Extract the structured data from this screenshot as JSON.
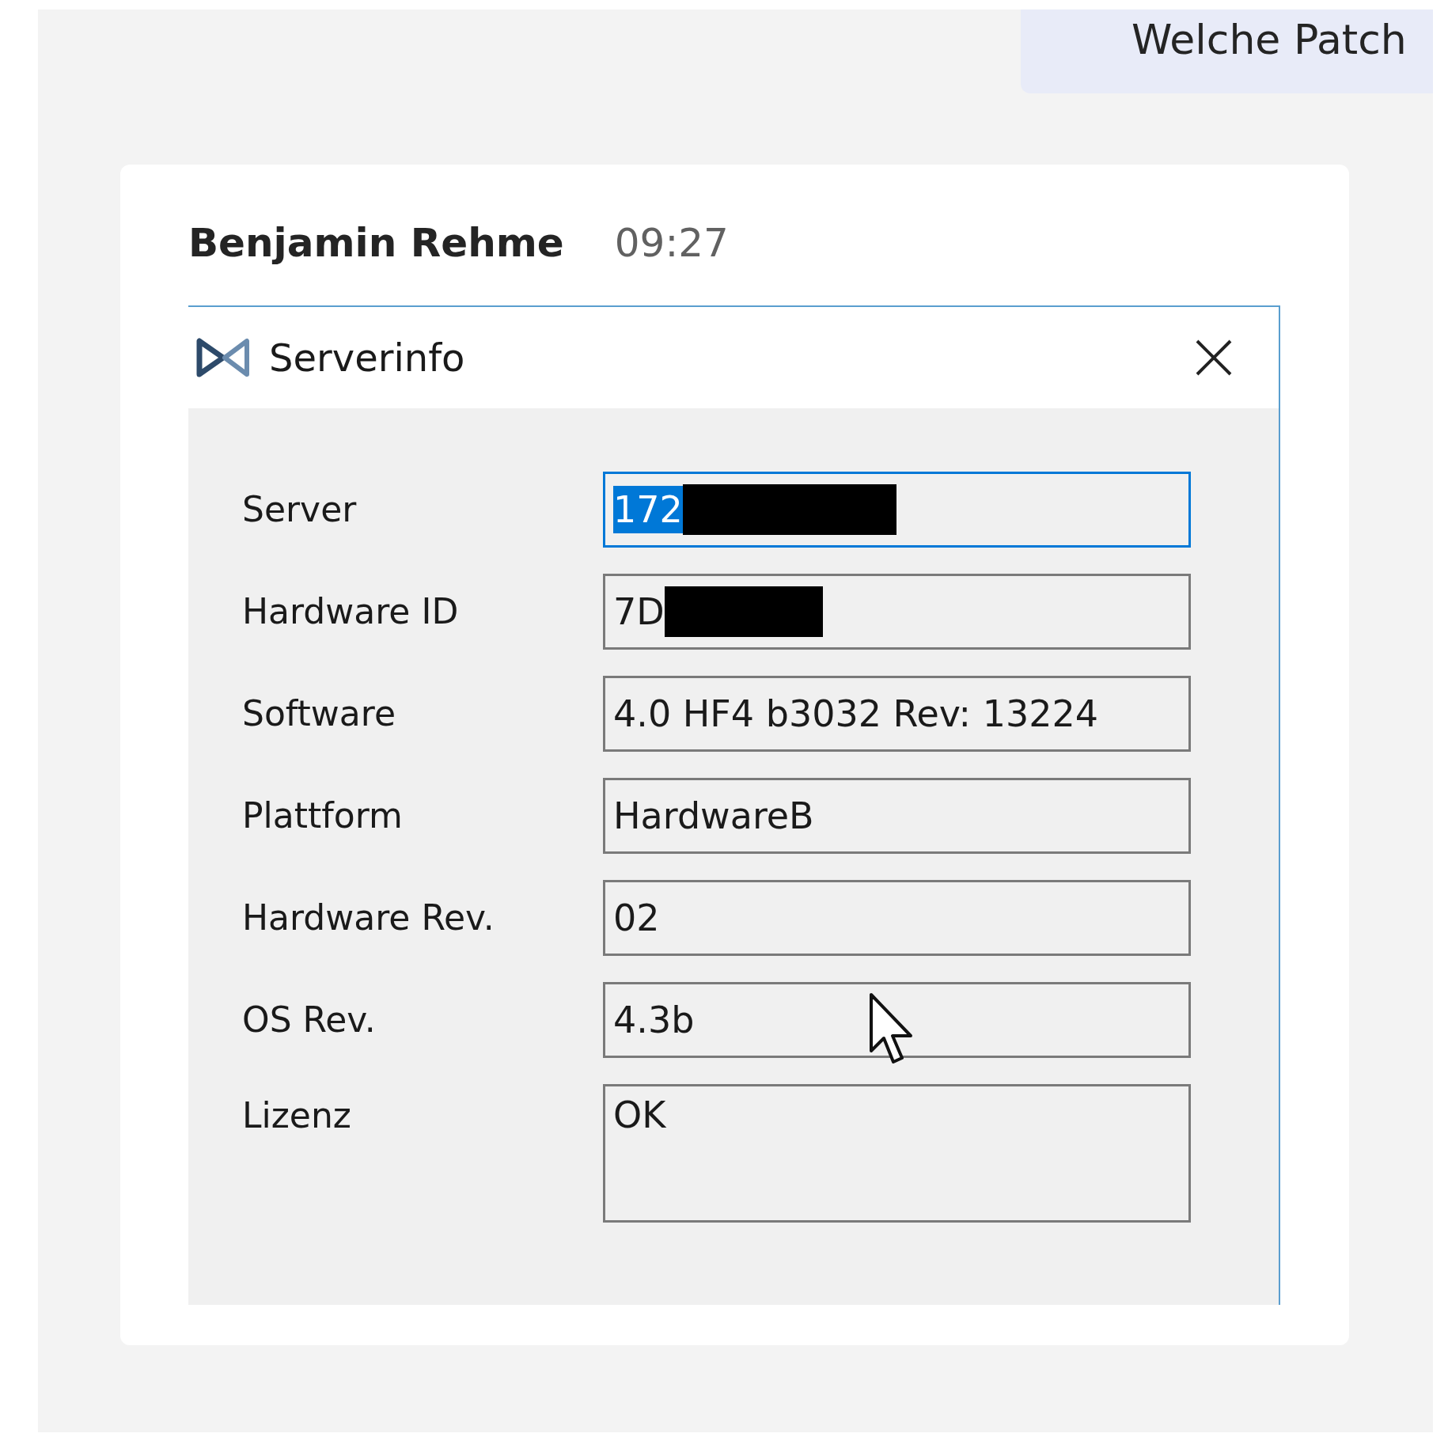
{
  "chat_bubble": {
    "text": "Welche Patch"
  },
  "message": {
    "sender": "Benjamin Rehme",
    "time": "09:27"
  },
  "dialog": {
    "title": "Serverinfo",
    "fields": [
      {
        "label": "Server",
        "value": "172",
        "redacted": true,
        "focused": true,
        "selected": true
      },
      {
        "label": "Hardware ID",
        "value": "7D",
        "redacted": true,
        "focused": false,
        "selected": false
      },
      {
        "label": "Software",
        "value": "4.0 HF4 b3032 Rev: 13224",
        "redacted": false,
        "focused": false,
        "selected": false
      },
      {
        "label": "Plattform",
        "value": "HardwareB",
        "redacted": false,
        "focused": false,
        "selected": false
      },
      {
        "label": "Hardware Rev.",
        "value": "02",
        "redacted": false,
        "focused": false,
        "selected": false
      },
      {
        "label": "OS Rev.",
        "value": "4.3b",
        "redacted": false,
        "focused": false,
        "selected": false
      },
      {
        "label": "Lizenz",
        "value": "OK",
        "redacted": false,
        "focused": false,
        "selected": false,
        "kind": "multiline"
      }
    ]
  }
}
